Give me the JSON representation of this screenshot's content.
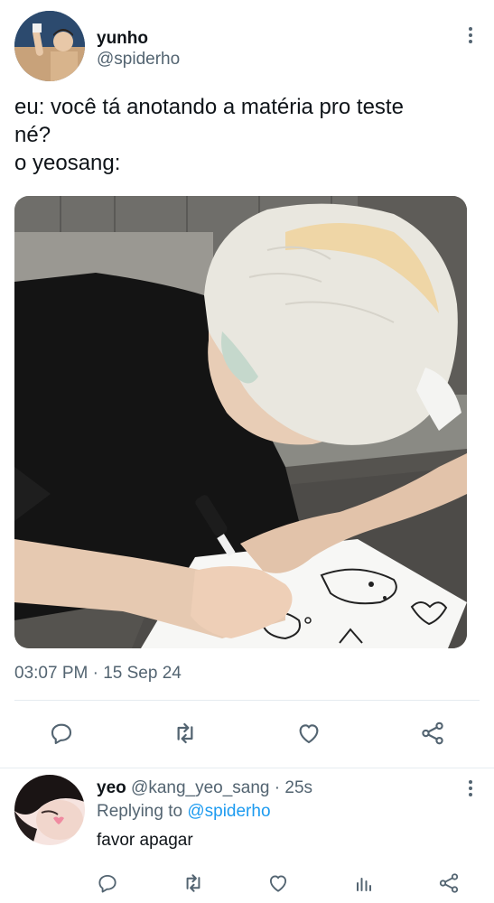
{
  "tweet": {
    "author_name": "yunho",
    "author_handle": "@spiderho",
    "text_lines": [
      "eu: você tá anotando a matéria pro teste",
      "né?",
      "o yeosang:"
    ],
    "time": "03:07 PM",
    "separator": "·",
    "date": "15 Sep 24"
  },
  "actions": {
    "icons": [
      "reply-icon",
      "retweet-icon",
      "like-icon",
      "share-icon"
    ]
  },
  "reply": {
    "author_name": "yeo",
    "author_handle": "@kang_yeo_sang",
    "separator": "·",
    "age": "25s",
    "replying_prefix": "Replying to",
    "replying_to": "@spiderho",
    "text": "favor apagar",
    "icons": [
      "reply-icon",
      "retweet-icon",
      "like-icon",
      "analytics-icon",
      "share-icon"
    ]
  },
  "colors": {
    "text": "#0f1419",
    "secondary": "#536471",
    "link": "#1d9bf0",
    "divider": "#e6ecf0"
  }
}
